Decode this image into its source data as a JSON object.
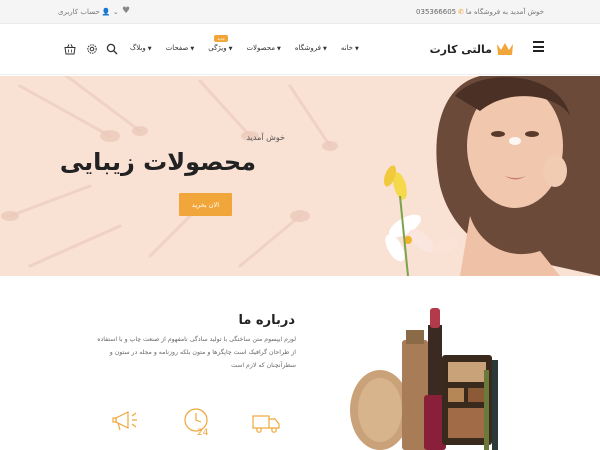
{
  "topbar": {
    "welcome_text": "خوش آمدید به فروشگاه ما",
    "phone": "035366605",
    "account_label": "حساب کاربری"
  },
  "header": {
    "logo_text": "مالتی کارت",
    "nav": [
      {
        "label": "خانه"
      },
      {
        "label": "فروشگاه"
      },
      {
        "label": "محصولات"
      },
      {
        "label": "ویژگی",
        "badge": "جدید"
      },
      {
        "label": "صفحات"
      },
      {
        "label": "وبلاگ"
      }
    ]
  },
  "hero": {
    "welcome": "خوش آمدید",
    "title": "محصولات زیبایی",
    "cta_label": "الان بخرید"
  },
  "about": {
    "title": "درباره ما",
    "body": "لورم ایپسوم متن ساختگی با تولید سادگی نامفهوم از صنعت چاپ و با استفاده از طراحان گرافیک است چاپگرها و متون بلکه روزنامه و مجله در ستون و سطرآنچنان که لازم است"
  },
  "features": [
    {
      "icon": "megaphone-icon"
    },
    {
      "icon": "support-24-icon"
    },
    {
      "icon": "delivery-truck-icon"
    }
  ],
  "colors": {
    "accent": "#f0a63a",
    "hero_bg": "#f9e1d4"
  }
}
